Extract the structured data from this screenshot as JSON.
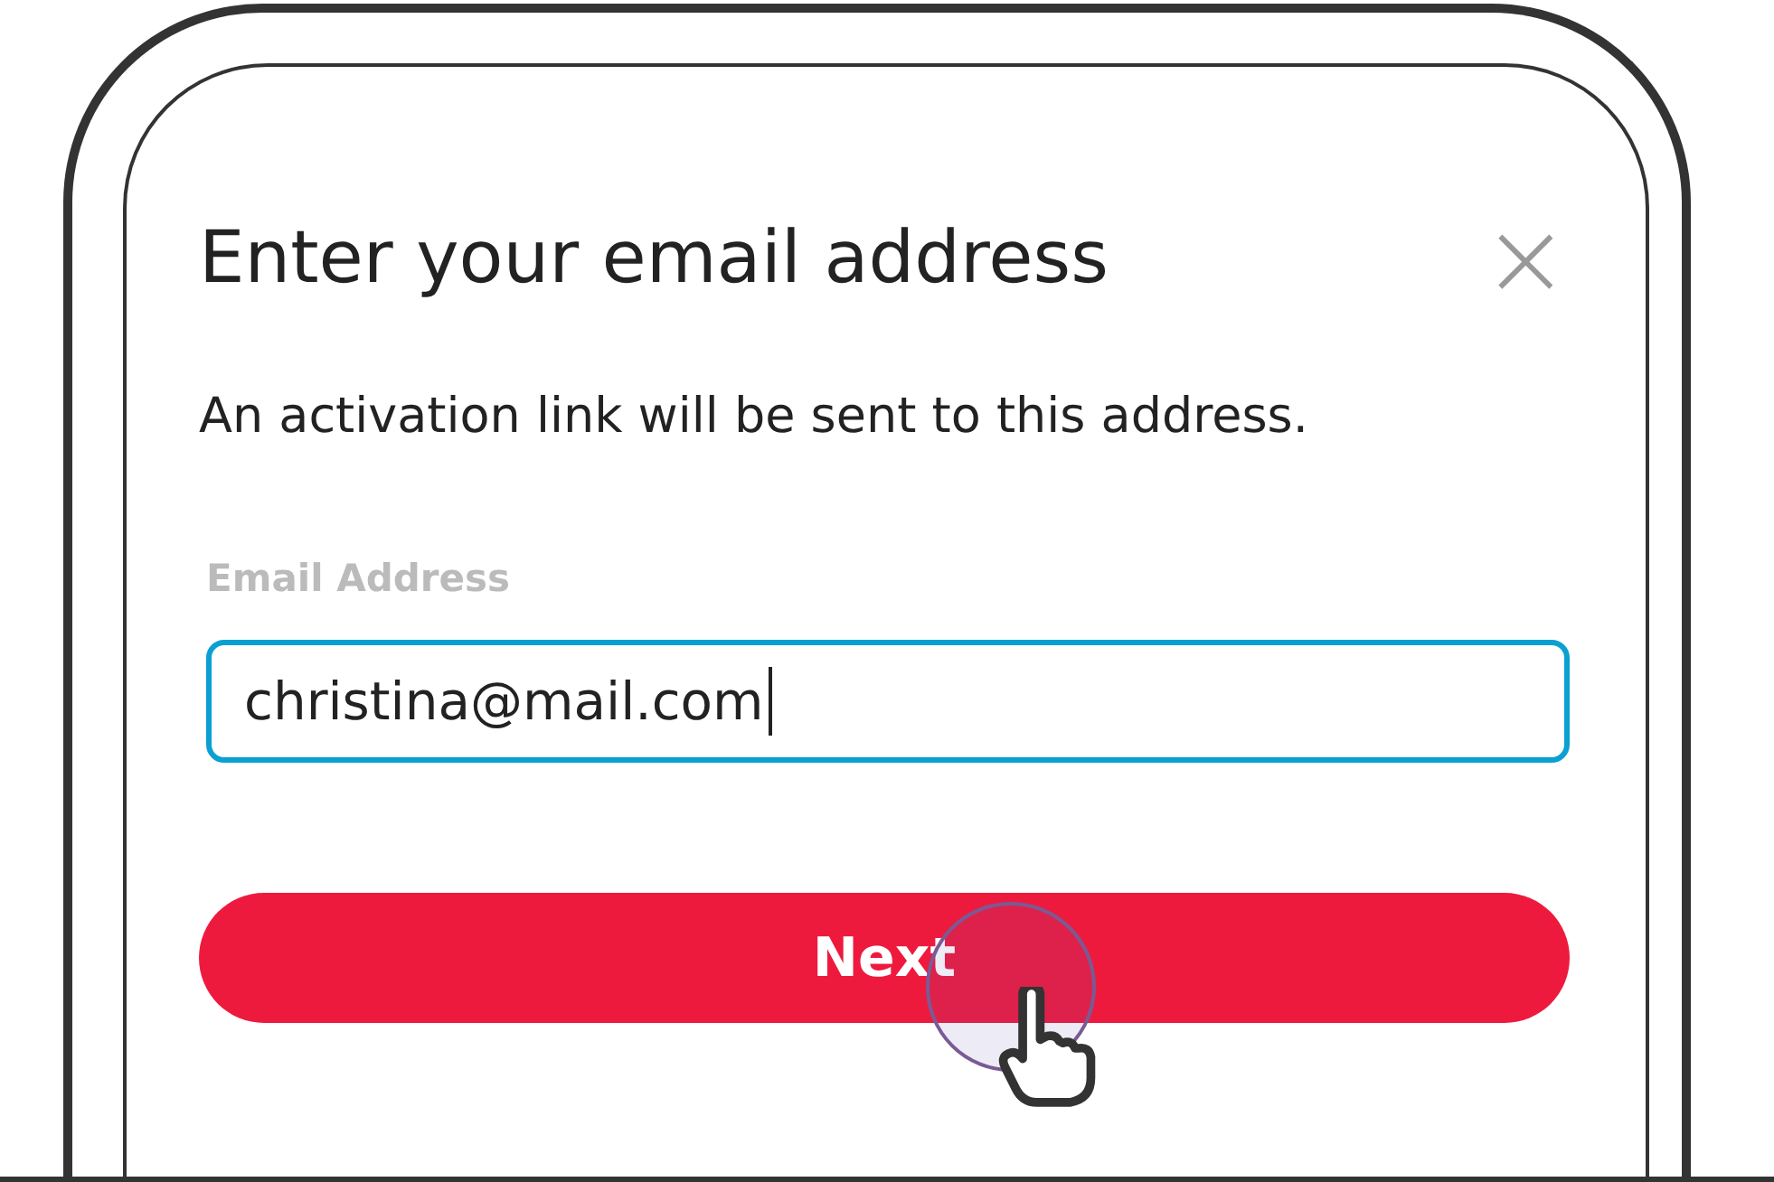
{
  "dialog": {
    "title": "Enter your email address",
    "close": "×",
    "message": "An activation link will be sent to this address.",
    "field": {
      "label": "Email Address",
      "value": "christina@mail.com",
      "focused": true
    },
    "button": {
      "label": "Next",
      "pressed": true
    }
  }
}
